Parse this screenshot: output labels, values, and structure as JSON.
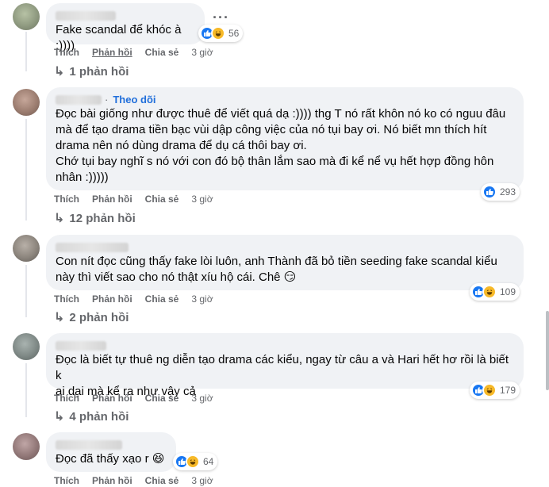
{
  "comments": [
    {
      "text": "Fake scandal để khóc à :))))",
      "reaction_count": "56",
      "actions": {
        "like": "Thích",
        "reply": "Phản hồi",
        "share": "Chia sẻ",
        "time": "3 giờ"
      },
      "replies": "1 phản hồi"
    },
    {
      "follow": "Theo dõi",
      "text": "Đọc bài giống như được thuê để viết quá dạ :)))) thg T nó rất khôn nó ko có nguu đâu\nmà để tạo drama tiền bạc vùi dập công việc của nó tụi bay ơi. Nó biết mn thích hít\ndrama nên nó dùng drama để dụ cá thôi bay ơi.\nChớ tụi bay nghĩ s nó với con đó bộ thân lắm sao mà đi kể nể vụ hết hợp đồng hôn\nnhân :)))))",
      "reaction_count": "293",
      "actions": {
        "like": "Thích",
        "reply": "Phản hồi",
        "share": "Chia sẻ",
        "time": "3 giờ"
      },
      "replies": "12 phản hồi"
    },
    {
      "text": "Con nít đọc cũng thấy fake lòi luôn, anh Thành đã bỏ tiền seeding fake scandal kiểu\nnày thì viết sao cho nó thật xíu hộ cái. Chê 😏",
      "reaction_count": "109",
      "actions": {
        "like": "Thích",
        "reply": "Phản hồi",
        "share": "Chia sẻ",
        "time": "3 giờ"
      },
      "replies": "2 phản hồi"
    },
    {
      "text": "Đọc là biết tự thuê ng diễn tạo drama các kiểu, ngay từ câu a và Hari hết hơ rồi là biết k\nai dại mà kể ra như vậy cả",
      "reaction_count": "179",
      "actions": {
        "like": "Thích",
        "reply": "Phản hồi",
        "share": "Chia sẻ",
        "time": "3 giờ"
      },
      "replies": "4 phản hồi"
    },
    {
      "text": "Đọc đã thấy xạo r 😆",
      "reaction_count": "64",
      "actions": {
        "like": "Thích",
        "reply": "Phản hồi",
        "share": "Chia sẻ",
        "time": "3 giờ"
      }
    }
  ],
  "icons": {
    "more": "more-horizontal-icon",
    "reply_arrow": "reply-arrow-icon",
    "like": "like-reaction-icon",
    "haha": "haha-reaction-icon"
  },
  "colors": {
    "bubble": "#f0f2f5",
    "link": "#216fdb",
    "muted": "#65676b",
    "like": "#1877f2",
    "haha": "#f7b928"
  }
}
